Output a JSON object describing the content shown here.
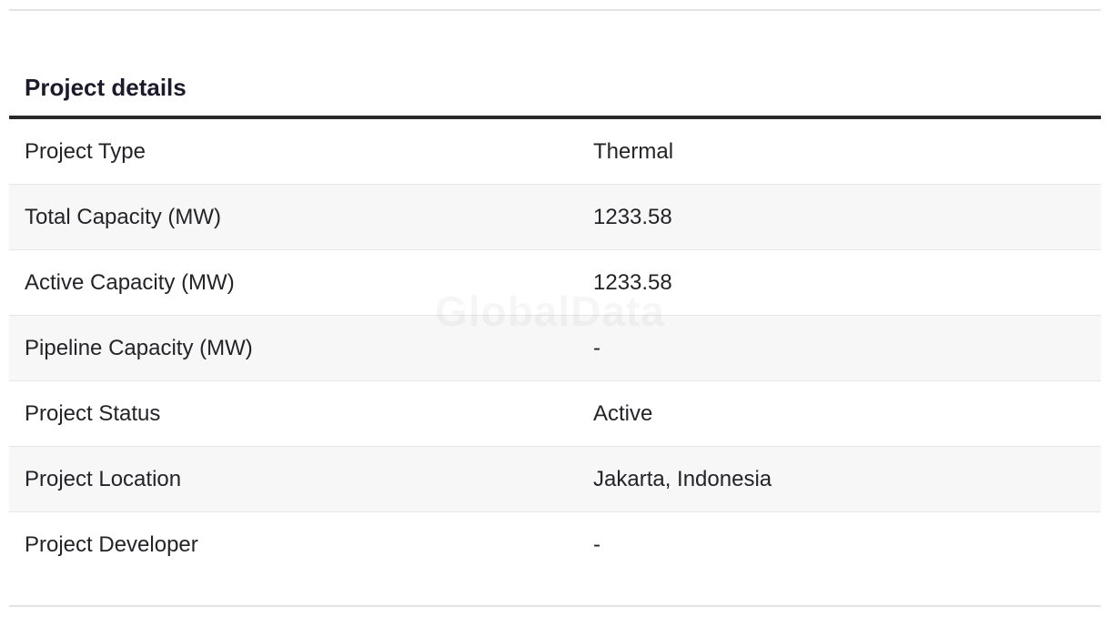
{
  "section": {
    "title": "Project details"
  },
  "watermark": "GlobalData",
  "details": [
    {
      "label": "Project Type",
      "value": "Thermal"
    },
    {
      "label": "Total Capacity (MW)",
      "value": "1233.58"
    },
    {
      "label": "Active Capacity (MW)",
      "value": "1233.58"
    },
    {
      "label": "Pipeline Capacity (MW)",
      "value": "-"
    },
    {
      "label": "Project Status",
      "value": "Active"
    },
    {
      "label": "Project Location",
      "value": "Jakarta, Indonesia"
    },
    {
      "label": "Project Developer",
      "value": "-"
    }
  ]
}
